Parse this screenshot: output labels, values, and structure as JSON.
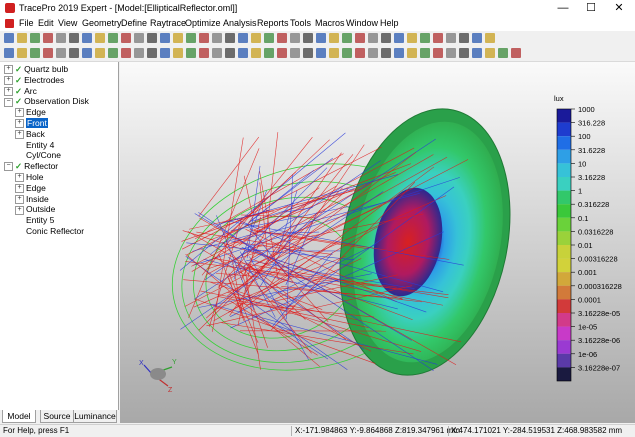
{
  "window": {
    "title": "TracePro 2019 Expert - [Model:[EllipticalReflector.oml]]",
    "minimize": "—",
    "maximize": "☐",
    "close": "✕"
  },
  "menu": [
    "File",
    "Edit",
    "View",
    "Geometry",
    "Define",
    "Raytrace",
    "Optimize",
    "Analysis",
    "Reports",
    "Tools",
    "Macros",
    "Window",
    "Help"
  ],
  "tree": [
    {
      "label": "Quartz bulb",
      "checked": true,
      "level": 0,
      "expander": "+"
    },
    {
      "label": "Electrodes",
      "checked": true,
      "level": 0,
      "expander": "+"
    },
    {
      "label": "Arc",
      "checked": true,
      "level": 0,
      "expander": "+"
    },
    {
      "label": "Observation Disk",
      "checked": true,
      "level": 0,
      "expander": "−"
    },
    {
      "label": "Edge",
      "level": 1,
      "expander": "+"
    },
    {
      "label": "Front",
      "level": 1,
      "expander": "+",
      "selected": true
    },
    {
      "label": "Back",
      "level": 1,
      "expander": "+"
    },
    {
      "label": "Entity 4",
      "level": 1
    },
    {
      "label": "Cyl/Cone",
      "level": 1
    },
    {
      "label": "Reflector",
      "checked": true,
      "level": 0,
      "expander": "−"
    },
    {
      "label": "Hole",
      "level": 1,
      "expander": "+"
    },
    {
      "label": "Edge",
      "level": 1,
      "expander": "+"
    },
    {
      "label": "Inside",
      "level": 1,
      "expander": "+"
    },
    {
      "label": "Outside",
      "level": 1,
      "expander": "+"
    },
    {
      "label": "Entity 5",
      "level": 1
    },
    {
      "label": "Conic Reflector",
      "level": 1
    }
  ],
  "tabs": [
    "Model",
    "Source",
    "Luminance"
  ],
  "legend": {
    "unit": "lux",
    "labels": [
      "1000",
      "316.228",
      "100",
      "31.6228",
      "10",
      "3.16228",
      "1",
      "0.316228",
      "0.1",
      "0.0316228",
      "0.01",
      "0.00316228",
      "0.001",
      "0.000316228",
      "0.0001",
      "3.16228e-05",
      "1e-05",
      "3.16228e-06",
      "1e-06",
      "3.16228e-07"
    ],
    "colors": [
      "#1a1a9a",
      "#1e3ccf",
      "#1f6ee6",
      "#2e9fe6",
      "#36c2d8",
      "#3ad0c0",
      "#32c86a",
      "#3ac83a",
      "#6ad23a",
      "#9ad23a",
      "#c8d23a",
      "#d2d23a",
      "#d2a83a",
      "#d27a3a",
      "#d23a3a",
      "#d23a8a",
      "#c83ac8",
      "#9a3ad2",
      "#5a3aa8",
      "#1a1a40"
    ]
  },
  "status": {
    "help": "For Help, press F1",
    "coords1": "X:-171.984863 Y:-9.864868 Z:819.347961 mm",
    "coords2": "X:474.171021 Y:-284.519531 Z:468.983582 mm"
  },
  "axis": {
    "x": "X",
    "y": "Y",
    "z": "Z"
  },
  "toolbar_colors": [
    "#2a5ab0",
    "#c8a020",
    "#3a8a3a",
    "#b03030",
    "#7a7a7a",
    "#404040"
  ]
}
